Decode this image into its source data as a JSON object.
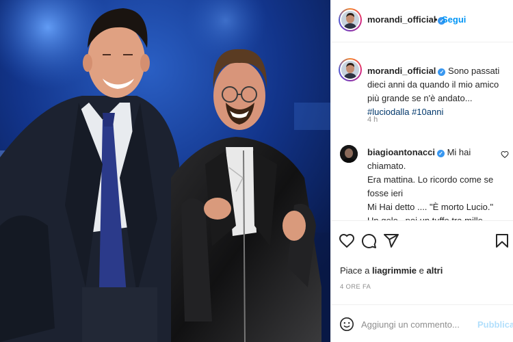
{
  "header": {
    "username": "morandi_official",
    "dot": "•",
    "follow_label": "Segui"
  },
  "caption": {
    "username": "morandi_official",
    "text": "Sono passati dieci anni da quando il mio amico più grande se n'è andato...",
    "hashtags": [
      "#luciodalla",
      "#10anni"
    ],
    "time": "4 h"
  },
  "comment": {
    "username": "biagioantonacci",
    "lines": [
      "Mi hai chiamato.",
      "Era mattina. Lo ricordo come se fosse ieri",
      "Mi Hai detto .... \"È morto Lucio.\"",
      "Un gelo , poi un tuffo tra mille"
    ]
  },
  "likes": {
    "prefix": "Piace a",
    "user": "liagrimmie",
    "conj": "e",
    "others": "altri"
  },
  "post_time": "4 ORE FA",
  "add_comment": {
    "placeholder": "Aggiungi un commento...",
    "publish_label": "Pubblica"
  },
  "icons": {
    "verified": "verified-badge-icon",
    "like": "heart-icon",
    "comment": "comment-icon",
    "share": "paper-plane-icon",
    "save": "bookmark-icon",
    "emoji": "smiley-icon"
  },
  "colors": {
    "accent": "#0095f6",
    "verified": "#3897f0",
    "hashtag": "#00376b",
    "muted": "#8e8e8e",
    "publish_disabled": "#b2dffc"
  }
}
